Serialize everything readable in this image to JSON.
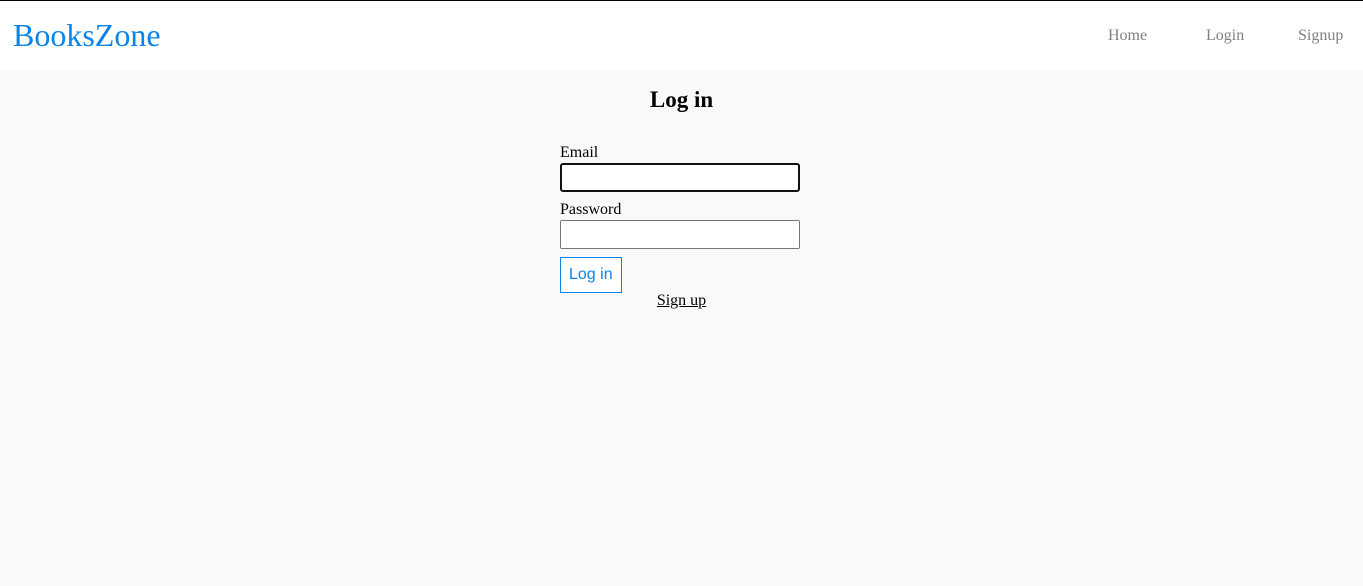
{
  "navbar": {
    "brand": "BooksZone",
    "links": [
      {
        "label": "Home"
      },
      {
        "label": "Login"
      },
      {
        "label": "Signup"
      }
    ]
  },
  "main": {
    "title": "Log in",
    "form": {
      "email_label": "Email",
      "email_value": "",
      "password_label": "Password",
      "password_value": "",
      "submit_label": "Log in"
    },
    "signup_link": "Sign up"
  },
  "colors": {
    "brand": "#0a84e6",
    "nav_link": "#808080",
    "background": "#f9f9f9",
    "navbar_background": "#ffffff"
  }
}
